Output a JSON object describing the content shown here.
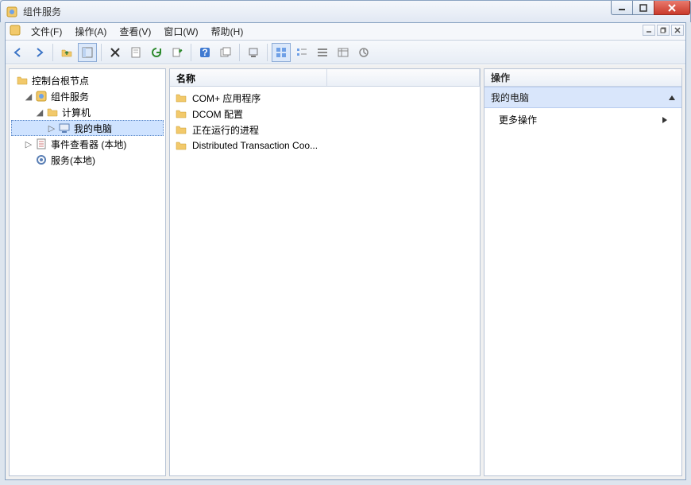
{
  "window": {
    "title": "组件服务"
  },
  "menu": {
    "file": "文件(F)",
    "action": "操作(A)",
    "view": "查看(V)",
    "window": "窗口(W)",
    "help": "帮助(H)"
  },
  "tree": {
    "root": "控制台根节点",
    "n1": "组件服务",
    "n2": "计算机",
    "n3": "我的电脑",
    "n4": "事件查看器 (本地)",
    "n5": "服务(本地)"
  },
  "list": {
    "header_name": "名称",
    "items": [
      "COM+ 应用程序",
      "DCOM 配置",
      "正在运行的进程",
      "Distributed Transaction Coo..."
    ]
  },
  "actions": {
    "header": "操作",
    "section": "我的电脑",
    "item_more": "更多操作"
  }
}
